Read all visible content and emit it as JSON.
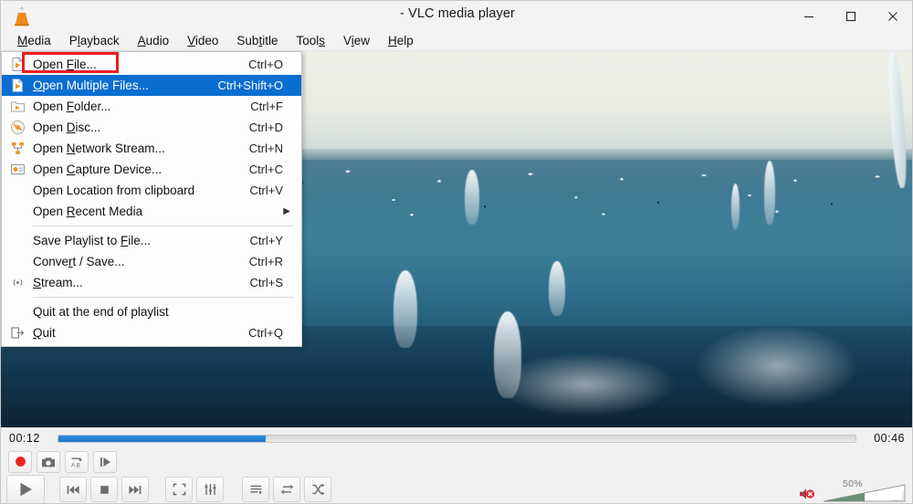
{
  "window": {
    "title": "- VLC media player",
    "logo_icon": "vlc-cone-icon",
    "minimize_label": "–",
    "maximize_label": "□",
    "close_label": "✕"
  },
  "menubar": {
    "items": [
      {
        "label": "Media",
        "accel": "M"
      },
      {
        "label": "Playback",
        "accel": "l"
      },
      {
        "label": "Audio",
        "accel": "A"
      },
      {
        "label": "Video",
        "accel": "V"
      },
      {
        "label": "Subtitle",
        "accel": "t"
      },
      {
        "label": "Tools",
        "accel": "s"
      },
      {
        "label": "View",
        "accel": "i"
      },
      {
        "label": "Help",
        "accel": "H"
      }
    ]
  },
  "media_menu": {
    "open": true,
    "highlighted_item": "Open Multiple Files...",
    "annotation_box_target": "Open File...",
    "annotation_color": "#ec1c24",
    "highlight_color": "#0a6ed1",
    "items": [
      {
        "label": "Open File...",
        "shortcut": "Ctrl+O",
        "icon": "open-file-icon",
        "selected": false,
        "submenu": false
      },
      {
        "label": "Open Multiple Files...",
        "shortcut": "Ctrl+Shift+O",
        "icon": "open-multiple-icon",
        "selected": true,
        "submenu": false
      },
      {
        "label": "Open Folder...",
        "shortcut": "Ctrl+F",
        "icon": "open-folder-icon",
        "selected": false,
        "submenu": false
      },
      {
        "label": "Open Disc...",
        "shortcut": "Ctrl+D",
        "icon": "disc-icon",
        "selected": false,
        "submenu": false
      },
      {
        "label": "Open Network Stream...",
        "shortcut": "Ctrl+N",
        "icon": "network-icon",
        "selected": false,
        "submenu": false
      },
      {
        "label": "Open Capture Device...",
        "shortcut": "Ctrl+C",
        "icon": "capture-device-icon",
        "selected": false,
        "submenu": false
      },
      {
        "label": "Open Location from clipboard",
        "shortcut": "Ctrl+V",
        "icon": "none",
        "selected": false,
        "submenu": false
      },
      {
        "label": "Open Recent Media",
        "shortcut": "",
        "icon": "none",
        "selected": false,
        "submenu": true
      },
      {
        "separator": true
      },
      {
        "label": "Save Playlist to File...",
        "shortcut": "Ctrl+Y",
        "icon": "none",
        "selected": false,
        "submenu": false
      },
      {
        "label": "Convert / Save...",
        "shortcut": "Ctrl+R",
        "icon": "none",
        "selected": false,
        "submenu": false
      },
      {
        "label": "Stream...",
        "shortcut": "Ctrl+S",
        "icon": "stream-icon",
        "selected": false,
        "submenu": false
      },
      {
        "separator": true
      },
      {
        "label": "Quit at the end of playlist",
        "shortcut": "",
        "icon": "none",
        "selected": false,
        "submenu": false
      },
      {
        "label": "Quit",
        "shortcut": "Ctrl+Q",
        "icon": "quit-icon",
        "selected": false,
        "submenu": false
      }
    ]
  },
  "video": {
    "description": "Seabirds plunge-diving into blue ocean water"
  },
  "controls": {
    "time_elapsed": "00:12",
    "time_total": "00:46",
    "progress_percent": 26,
    "seek_fill_color": "#1877cc",
    "tools": [
      {
        "name": "record-button",
        "icon": "record-icon"
      },
      {
        "name": "snapshot-button",
        "icon": "camera-icon"
      },
      {
        "name": "ab-loop-button",
        "icon": "ab-loop-icon"
      },
      {
        "name": "frame-by-frame-button",
        "icon": "frame-step-icon"
      }
    ],
    "playback": [
      {
        "name": "play-button",
        "icon": "play-icon"
      },
      {
        "name": "previous-button",
        "icon": "previous-icon"
      },
      {
        "name": "stop-button",
        "icon": "stop-icon"
      },
      {
        "name": "next-button",
        "icon": "next-icon"
      },
      {
        "name": "fullscreen-button",
        "icon": "fullscreen-icon"
      },
      {
        "name": "settings-button",
        "icon": "equalizer-icon"
      },
      {
        "name": "playlist-button",
        "icon": "playlist-icon"
      },
      {
        "name": "loop-button",
        "icon": "loop-icon"
      },
      {
        "name": "shuffle-button",
        "icon": "shuffle-icon"
      }
    ],
    "volume": {
      "level_label": "50%",
      "muted": true,
      "mute_icon": "speaker-muted-icon"
    }
  }
}
